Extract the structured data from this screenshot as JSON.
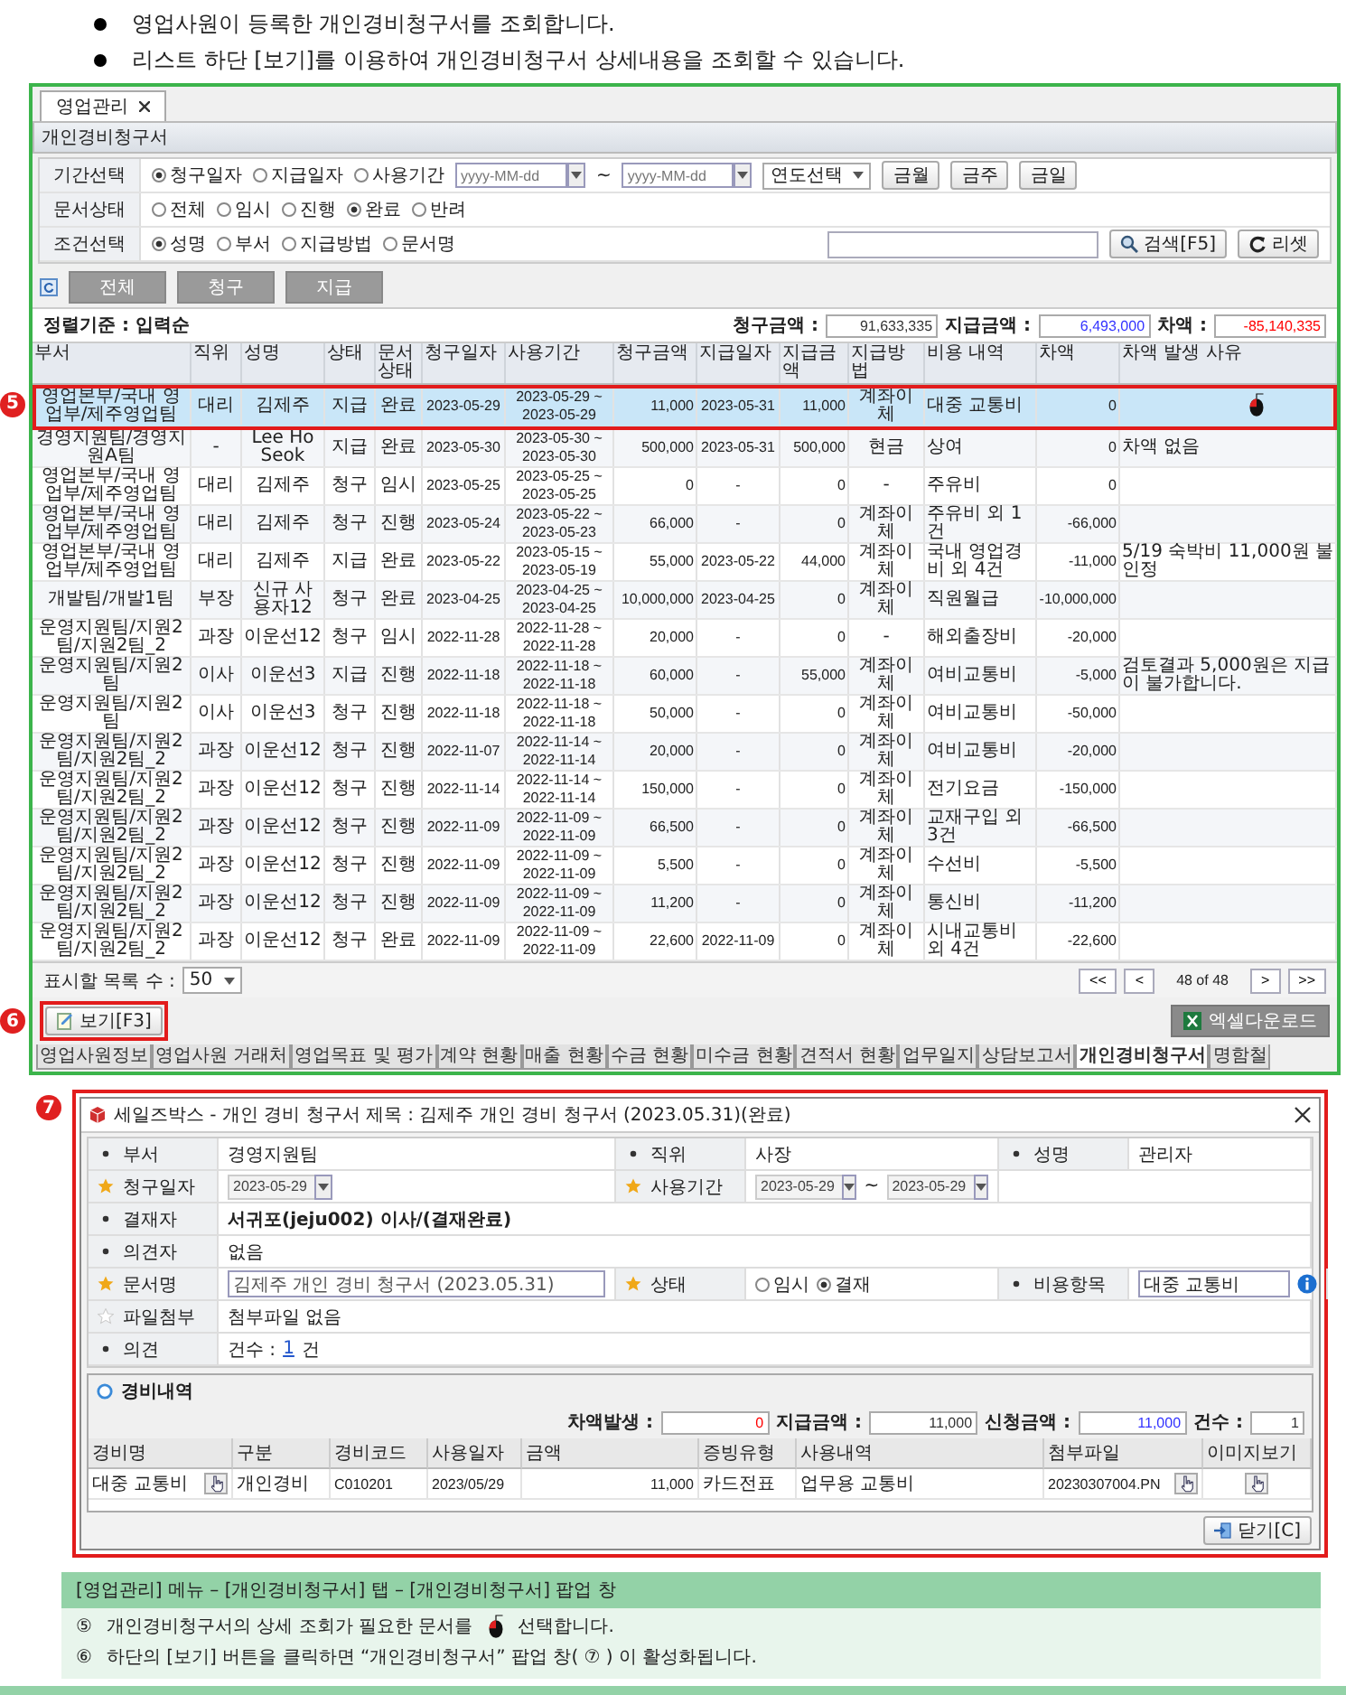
{
  "instructions": [
    "영업사원이 등록한 개인경비청구서를 조회합니다.",
    "리스트 하단 [보기]를 이용하여 개인경비청구서 상세내용을 조회할 수 있습니다."
  ],
  "app": {
    "top_tab": "영업관리",
    "section_title": "개인경비청구서",
    "filters": [
      {
        "label": "기간선택",
        "kind": "period",
        "options": [
          {
            "label": "청구일자",
            "selected": true
          },
          {
            "label": "지급일자",
            "selected": false
          },
          {
            "label": "사용기간",
            "selected": false
          }
        ],
        "from_placeholder": "yyyy-MM-dd",
        "separator": "~",
        "to_placeholder": "yyyy-MM-dd",
        "year_select": "연도선택",
        "buttons": [
          "금월",
          "금주",
          "금일"
        ]
      },
      {
        "label": "문서상태",
        "kind": "radios",
        "options": [
          {
            "label": "전체",
            "selected": false
          },
          {
            "label": "임시",
            "selected": false
          },
          {
            "label": "진행",
            "selected": false
          },
          {
            "label": "완료",
            "selected": true
          },
          {
            "label": "반려",
            "selected": false
          }
        ]
      },
      {
        "label": "조건선택",
        "kind": "search",
        "options": [
          {
            "label": "성명",
            "selected": true
          },
          {
            "label": "부서",
            "selected": false
          },
          {
            "label": "지급방법",
            "selected": false
          },
          {
            "label": "문서명",
            "selected": false
          }
        ],
        "search_button": "검색[F5]",
        "reset_button": "리셋"
      }
    ],
    "view_buttons": [
      "전체",
      "청구",
      "지급"
    ],
    "sort_label": "정렬기준 : 입력순",
    "totals": [
      {
        "label": "청구금액 :",
        "value": "91,633,335",
        "color": "#333333"
      },
      {
        "label": "지급금액 :",
        "value": "6,493,000",
        "color": "#3333ff"
      },
      {
        "label": "차액 :",
        "value": "-85,140,335",
        "color": "#ff0000"
      }
    ],
    "table": {
      "annotation": "5",
      "columns": [
        "부서",
        "직위",
        "성명",
        "상태",
        "문서상태",
        "청구일자",
        "사용기간",
        "청구금액",
        "지급일자",
        "지급금액",
        "지급방법",
        "비용 내역",
        "차액",
        "차액 발생 사유"
      ],
      "rows": [
        {
          "selected": true,
          "cells": [
            "영업본부/국내 영업부/제주영업팀",
            "대리",
            "김제주",
            "지급",
            "완료",
            "2023-05-29",
            "2023-05-29 ~ 2023-05-29",
            "11,000",
            "2023-05-31",
            "11,000",
            "계좌이체",
            "대중 교통비",
            "0"
          ]
        },
        {
          "selected": false,
          "cells": [
            "경영지원팀/경영지원A팀",
            "-",
            "Lee Ho Seok",
            "지급",
            "완료",
            "2023-05-30",
            "2023-05-30 ~ 2023-05-30",
            "500,000",
            "2023-05-31",
            "500,000",
            "현금",
            "상여",
            "0"
          ],
          "reason": "차액 없음"
        },
        {
          "selected": false,
          "cells": [
            "영업본부/국내 영업부/제주영업팀",
            "대리",
            "김제주",
            "청구",
            "임시",
            "2023-05-25",
            "2023-05-25 ~ 2023-05-25",
            "0",
            "-",
            "0",
            "-",
            "주유비",
            "0"
          ]
        },
        {
          "selected": false,
          "cells": [
            "영업본부/국내 영업부/제주영업팀",
            "대리",
            "김제주",
            "청구",
            "진행",
            "2023-05-24",
            "2023-05-22 ~ 2023-05-23",
            "66,000",
            "-",
            "0",
            "계좌이체",
            "주유비 외 1건",
            "-66,000"
          ]
        },
        {
          "selected": false,
          "cells": [
            "영업본부/국내 영업부/제주영업팀",
            "대리",
            "김제주",
            "지급",
            "완료",
            "2023-05-22",
            "2023-05-15 ~ 2023-05-19",
            "55,000",
            "2023-05-22",
            "44,000",
            "계좌이체",
            "국내 영업경비 외 4건",
            "-11,000"
          ],
          "reason": "5/19 숙박비 11,000원 불인정"
        },
        {
          "selected": false,
          "cells": [
            "개발팀/개발1팀",
            "부장",
            "신규 사용자12",
            "청구",
            "완료",
            "2023-04-25",
            "2023-04-25 ~ 2023-04-25",
            "10,000,000",
            "2023-04-25",
            "0",
            "계좌이체",
            "직원월급",
            "-10,000,000"
          ]
        },
        {
          "selected": false,
          "cells": [
            "운영지원팀/지원2팀/지원2팀_2",
            "과장",
            "이운선12",
            "청구",
            "임시",
            "2022-11-28",
            "2022-11-28 ~ 2022-11-28",
            "20,000",
            "-",
            "0",
            "-",
            "해외출장비",
            "-20,000"
          ]
        },
        {
          "selected": false,
          "cells": [
            "운영지원팀/지원2팀",
            "이사",
            "이운선3",
            "지급",
            "진행",
            "2022-11-18",
            "2022-11-18 ~ 2022-11-18",
            "60,000",
            "-",
            "55,000",
            "계좌이체",
            "여비교통비",
            "-5,000"
          ],
          "reason": "검토결과 5,000원은 지급이 불가합니다."
        },
        {
          "selected": false,
          "cells": [
            "운영지원팀/지원2팀",
            "이사",
            "이운선3",
            "청구",
            "진행",
            "2022-11-18",
            "2022-11-18 ~ 2022-11-18",
            "50,000",
            "-",
            "0",
            "계좌이체",
            "여비교통비",
            "-50,000"
          ]
        },
        {
          "selected": false,
          "cells": [
            "운영지원팀/지원2팀/지원2팀_2",
            "과장",
            "이운선12",
            "청구",
            "진행",
            "2022-11-07",
            "2022-11-14 ~ 2022-11-14",
            "20,000",
            "-",
            "0",
            "계좌이체",
            "여비교통비",
            "-20,000"
          ]
        },
        {
          "selected": false,
          "cells": [
            "운영지원팀/지원2팀/지원2팀_2",
            "과장",
            "이운선12",
            "청구",
            "진행",
            "2022-11-14",
            "2022-11-14 ~ 2022-11-14",
            "150,000",
            "-",
            "0",
            "계좌이체",
            "전기요금",
            "-150,000"
          ]
        },
        {
          "selected": false,
          "cells": [
            "운영지원팀/지원2팀/지원2팀_2",
            "과장",
            "이운선12",
            "청구",
            "진행",
            "2022-11-09",
            "2022-11-09 ~ 2022-11-09",
            "66,500",
            "-",
            "0",
            "계좌이체",
            "교재구입 외 3건",
            "-66,500"
          ]
        },
        {
          "selected": false,
          "cells": [
            "운영지원팀/지원2팀/지원2팀_2",
            "과장",
            "이운선12",
            "청구",
            "진행",
            "2022-11-09",
            "2022-11-09 ~ 2022-11-09",
            "5,500",
            "-",
            "0",
            "계좌이체",
            "수선비",
            "-5,500"
          ]
        },
        {
          "selected": false,
          "cells": [
            "운영지원팀/지원2팀/지원2팀_2",
            "과장",
            "이운선12",
            "청구",
            "진행",
            "2022-11-09",
            "2022-11-09 ~ 2022-11-09",
            "11,200",
            "-",
            "0",
            "계좌이체",
            "통신비",
            "-11,200"
          ]
        },
        {
          "selected": false,
          "cells": [
            "운영지원팀/지원2팀/지원2팀_2",
            "과장",
            "이운선12",
            "청구",
            "완료",
            "2022-11-09",
            "2022-11-09 ~ 2022-11-09",
            "22,600",
            "2022-11-09",
            "0",
            "계좌이체",
            "시내교통비 외 4건",
            "-22,600"
          ]
        }
      ]
    },
    "page_size_label": "표시할 목록 수 :",
    "page_size": "50",
    "pager": {
      "first": "<<",
      "prev": "<",
      "info": "48 of 48",
      "next": ">",
      "last": ">>"
    },
    "view_button": {
      "label": "보기[F3]",
      "annotation": "6"
    },
    "excel_button": "엑셀다운로드",
    "bottom_tabs": [
      {
        "label": "영업사원정보",
        "selected": false
      },
      {
        "label": "영업사원 거래처",
        "selected": false
      },
      {
        "label": "영업목표 및 평가",
        "selected": false
      },
      {
        "label": "계약 현황",
        "selected": false
      },
      {
        "label": "매출 현황",
        "selected": false
      },
      {
        "label": "수금 현황",
        "selected": false
      },
      {
        "label": "미수금 현황",
        "selected": false
      },
      {
        "label": "견적서 현황",
        "selected": false
      },
      {
        "label": "업무일지",
        "selected": false
      },
      {
        "label": "상담보고서",
        "selected": false
      },
      {
        "label": "개인경비청구서",
        "selected": true
      },
      {
        "label": "명함철",
        "selected": false
      }
    ]
  },
  "popup": {
    "annotation": "7",
    "title": "세일즈박스 - 개인 경비 청구서 제목 : 김제주 개인 경비 청구서 (2023.05.31)(완료)",
    "form": [
      [
        {
          "label": "부서",
          "star": false,
          "kind": "text",
          "value": "경영지원팀"
        },
        {
          "label": "직위",
          "star": false,
          "kind": "text",
          "value": "사장"
        },
        {
          "label": "성명",
          "star": false,
          "kind": "text",
          "value": "관리자"
        }
      ],
      [
        {
          "label": "청구일자",
          "star": true,
          "required": true,
          "kind": "date",
          "value": "2023-05-29"
        },
        {
          "label": "사용기간",
          "star": true,
          "required": true,
          "kind": "date_range",
          "value": "2023-05-29",
          "separator": "~",
          "value_to": "2023-05-29"
        }
      ],
      [
        {
          "label": "결재자",
          "star": false,
          "kind": "bold",
          "value": "서귀포(jeju002) 이사/(결재완료)"
        }
      ],
      [
        {
          "label": "의견자",
          "star": false,
          "kind": "text",
          "value": "없음"
        }
      ],
      [
        {
          "label": "문서명",
          "star": true,
          "required": true,
          "kind": "input",
          "value": "김제주 개인 경비 청구서 (2023.05.31)"
        },
        {
          "label": "상태",
          "star": true,
          "required": true,
          "kind": "radios",
          "options": [
            {
              "label": "임시",
              "selected": false
            },
            {
              "label": "결재",
              "selected": true
            }
          ]
        },
        {
          "label": "비용항목",
          "star": false,
          "kind": "input_info",
          "value": "대중 교통비"
        }
      ],
      [
        {
          "label": "파일첨부",
          "star": true,
          "required": false,
          "kind": "text",
          "value": "첨부파일 없음"
        }
      ],
      [
        {
          "label": "의견",
          "star": false,
          "kind": "count",
          "prefix": "건수 :",
          "link": "1",
          "suffix": "건"
        }
      ]
    ],
    "section_title": "경비내역",
    "totals": [
      {
        "label": "차액발생 :",
        "value": "0",
        "color": "#ff0000"
      },
      {
        "label": "지급금액 :",
        "value": "11,000",
        "color": "#333333"
      },
      {
        "label": "신청금액 :",
        "value": "11,000",
        "color": "#3333ff"
      },
      {
        "label": "건수 :",
        "value": "1",
        "color": "#333333"
      }
    ],
    "columns": [
      "경비명",
      "구분",
      "경비코드",
      "사용일자",
      "금액",
      "증빙유형",
      "사용내역",
      "첨부파일",
      "이미지보기"
    ],
    "items": [
      {
        "name": "대중 교통비",
        "type": "개인경비",
        "code": "C010201",
        "date": "2023/05/29",
        "amount": "11,000",
        "proof": "카드전표",
        "usage": "업무용 교통비",
        "file": "20230307004.PN"
      }
    ],
    "close_button": "닫기[C]"
  },
  "note": {
    "title": "[영업관리] 메뉴 – [개인경비청구서] 탭 – [개인경비청구서] 팝업 창",
    "items": [
      {
        "marker": "⑤",
        "text": "개인경비청구서의 상세 조회가 필요한 문서를",
        "text_after": "선택합니다."
      },
      {
        "marker": "⑥",
        "text": "하단의 [보기] 버튼을 클릭하면 “개인경비청구서” 팝업 창( ⑦ ) 이 활성화됩니다."
      }
    ]
  }
}
